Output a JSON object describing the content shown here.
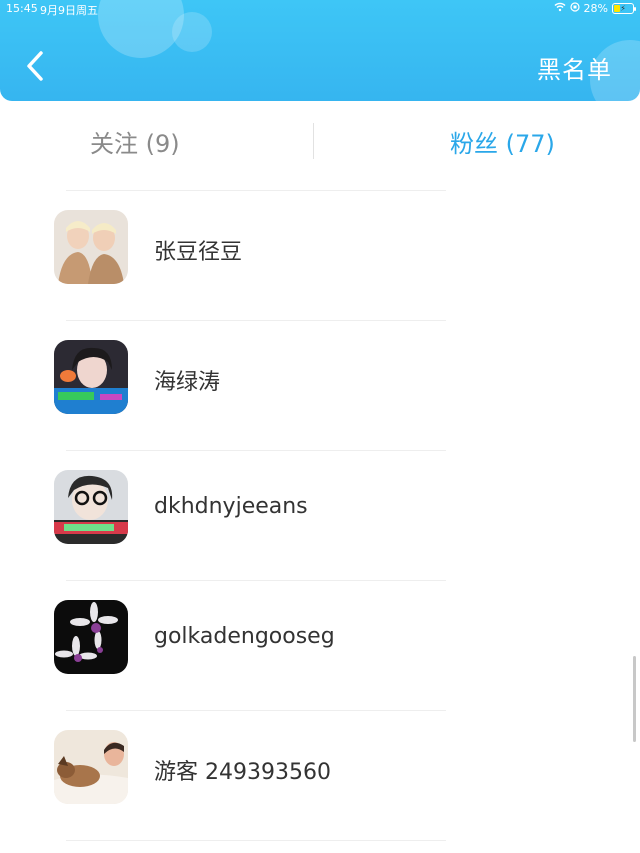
{
  "status_bar": {
    "time": "15:45",
    "date": "9月9日周五",
    "battery": "28%",
    "battery_level": 0.28
  },
  "header": {
    "blacklist_label": "黑名单",
    "accent_color": "#36b5f0"
  },
  "tabs": [
    {
      "label": "关注 (9)",
      "active": false
    },
    {
      "label": "粉丝 (77)",
      "active": true
    }
  ],
  "fans": [
    {
      "name": "张豆径豆",
      "avatar": "twins-avatar"
    },
    {
      "name": "海绿涛",
      "avatar": "girl-photo-avatar"
    },
    {
      "name": "dkhdnyjeeans",
      "avatar": "glasses-girl-avatar"
    },
    {
      "name": "golkadengooseg",
      "avatar": "orchid-avatar"
    },
    {
      "name": "游客 249393560",
      "avatar": "dog-sleeping-avatar"
    }
  ]
}
